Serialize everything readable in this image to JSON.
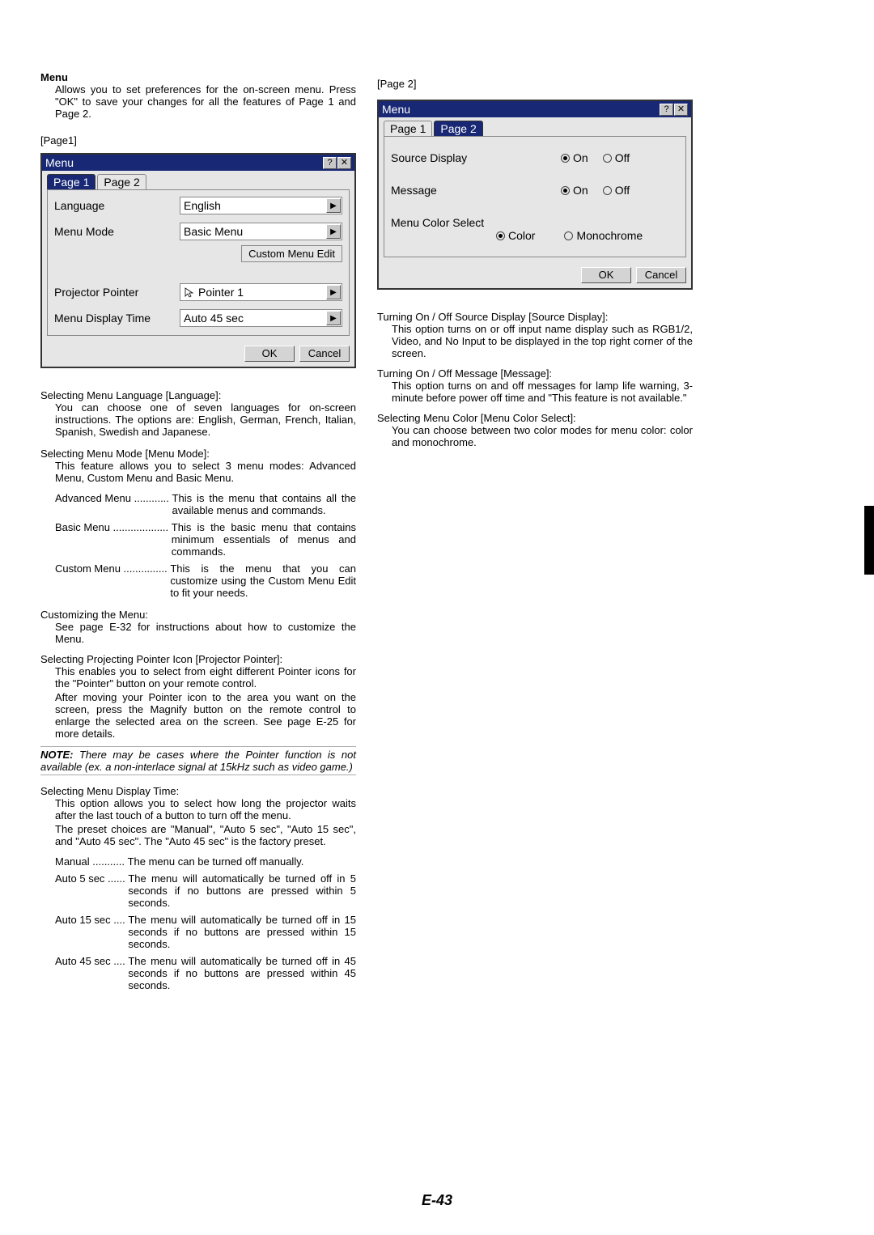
{
  "left": {
    "menu_heading": "Menu",
    "menu_intro": "Allows you to set preferences for the on-screen menu. Press \"OK\" to save your changes for all the features of Page 1 and Page 2.",
    "page1_label": "[Page1]",
    "dlg1": {
      "title": "Menu",
      "help": "?",
      "close": "✕",
      "tab1": "Page 1",
      "tab2": "Page 2",
      "language_label": "Language",
      "language_value": "English",
      "menumode_label": "Menu Mode",
      "menumode_value": "Basic Menu",
      "custom_edit": "Custom Menu Edit",
      "pointer_label": "Projector Pointer",
      "pointer_value": "Pointer 1",
      "displaytime_label": "Menu Display Time",
      "displaytime_value": "Auto 45 sec",
      "ok": "OK",
      "cancel": "Cancel",
      "tri": "▶"
    },
    "sec_lang_h": "Selecting Menu Language [Language]:",
    "sec_lang_b": "You can choose one of seven languages for on-screen instructions. The options are: English, German, French, Italian, Spanish, Swedish and Japanese.",
    "sec_mode_h": "Selecting Menu Mode [Menu Mode]:",
    "sec_mode_b": "This feature allows you to select 3 menu modes: Advanced Menu, Custom Menu and Basic Menu.",
    "defs_mode": [
      {
        "term": "Advanced Menu ............ ",
        "body": "This is the menu that contains all the available menus and commands."
      },
      {
        "term": "Basic Menu ................... ",
        "body": "This is the basic menu that contains minimum essentials of menus and commands."
      },
      {
        "term": "Custom Menu ............... ",
        "body": "This is the menu that you can customize using the Custom Menu Edit to fit your needs."
      }
    ],
    "sec_custom_h": "Customizing the Menu:",
    "sec_custom_b": "See page E-32 for instructions about how to customize the Menu.",
    "sec_ptr_h": "Selecting Projecting Pointer Icon [Projector Pointer]:",
    "sec_ptr_b1": "This enables you to select from eight different Pointer icons for the \"Pointer\" button on your remote control.",
    "sec_ptr_b2": "After moving your Pointer icon to the area you want on the screen, press the Magnify button on the remote control to enlarge the selected area on the screen. See page E-25 for more details.",
    "note_label": "NOTE:",
    "note_body": " There may be cases where the Pointer function is not available (ex. a non-interlace signal at 15kHz such as video game.)",
    "sec_time_h": "Selecting Menu Display Time:",
    "sec_time_b1": "This option allows you to select how long the projector waits after the last touch of a button to turn off the menu.",
    "sec_time_b2": "The preset choices are \"Manual\", \"Auto 5 sec\", \"Auto 15 sec\", and \"Auto 45 sec\". The \"Auto 45 sec\" is the factory preset.",
    "defs_time": [
      {
        "term": "Manual ........... ",
        "body": "The menu can be turned off manually."
      },
      {
        "term": "Auto 5 sec ...... ",
        "body": "The menu will automatically be turned off in 5 seconds if no buttons are pressed within 5 seconds."
      },
      {
        "term": "Auto 15 sec .... ",
        "body": "The menu will automatically be turned off in 15 seconds if no buttons are pressed within 15 seconds."
      },
      {
        "term": "Auto 45 sec .... ",
        "body": "The menu will automatically be turned off in 45 seconds if no buttons are pressed within 45 seconds."
      }
    ]
  },
  "right": {
    "page2_label": "[Page 2]",
    "dlg2": {
      "title": "Menu",
      "help": "?",
      "close": "✕",
      "tab1": "Page 1",
      "tab2": "Page 2",
      "src_label": "Source Display",
      "msg_label": "Message",
      "color_label": "Menu Color Select",
      "on": "On",
      "off": "Off",
      "color": "Color",
      "mono": "Monochrome",
      "ok": "OK",
      "cancel": "Cancel"
    },
    "sec_src_h": "Turning On / Off Source Display [Source Display]:",
    "sec_src_b": "This option turns on or off input name display such as RGB1/2, Video, and No Input to be displayed in the top right corner of the screen.",
    "sec_msg_h": "Turning On / Off Message [Message]:",
    "sec_msg_b": "This option turns on and off messages for lamp life warning, 3-minute before power off time and \"This feature is not available.\"",
    "sec_clr_h": "Selecting Menu Color [Menu Color Select]:",
    "sec_clr_b": "You can choose between two color modes for menu color: color and monochrome."
  },
  "footer": "E-43"
}
